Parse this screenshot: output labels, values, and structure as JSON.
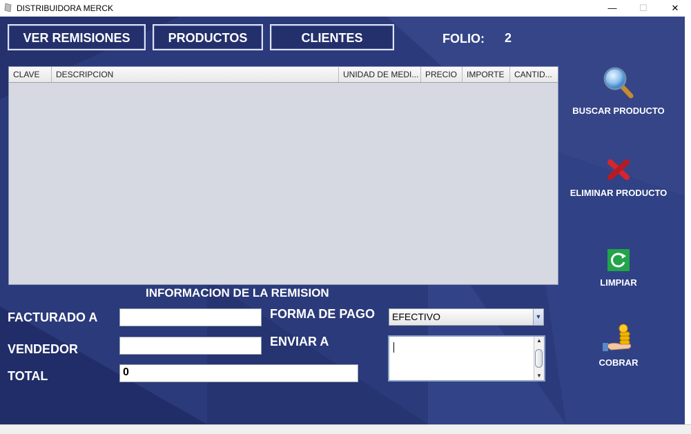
{
  "window": {
    "title": "DISTRIBUIDORA MERCK",
    "minimize": "—",
    "maximize": "☐",
    "close": "✕"
  },
  "toolbar": {
    "ver_remisiones": "VER REMISIONES",
    "productos": "PRODUCTOS",
    "clientes": "CLIENTES",
    "folio_label": "FOLIO:",
    "folio_value": "2"
  },
  "table": {
    "columns": [
      "CLAVE",
      "DESCRIPCION",
      "UNIDAD DE MEDI...",
      "PRECIO",
      "IMPORTE",
      "CANTID..."
    ],
    "rows": []
  },
  "side_actions": {
    "buscar": {
      "label": "BUSCAR PRODUCTO",
      "icon": "magnifier-icon"
    },
    "eliminar": {
      "label": "ELIMINAR PRODUCTO",
      "icon": "red-x-icon"
    },
    "limpiar": {
      "label": "LIMPIAR",
      "icon": "refresh-icon"
    },
    "cobrar": {
      "label": "COBRAR",
      "icon": "coins-hand-icon"
    }
  },
  "form": {
    "section_title": "INFORMACION DE LA REMISION",
    "facturado_label": "FACTURADO A",
    "facturado_value": "",
    "vendedor_label": "VENDEDOR",
    "vendedor_value": "",
    "total_label": "TOTAL",
    "total_value": "0",
    "forma_pago_label": "FORMA DE PAGO",
    "forma_pago_value": "EFECTIVO",
    "enviar_label": "ENVIAR A",
    "enviar_value": ""
  },
  "colors": {
    "background": "#2b3a7a",
    "button_border": "#dfe3f2",
    "table_bg": "#d6d9e1"
  }
}
